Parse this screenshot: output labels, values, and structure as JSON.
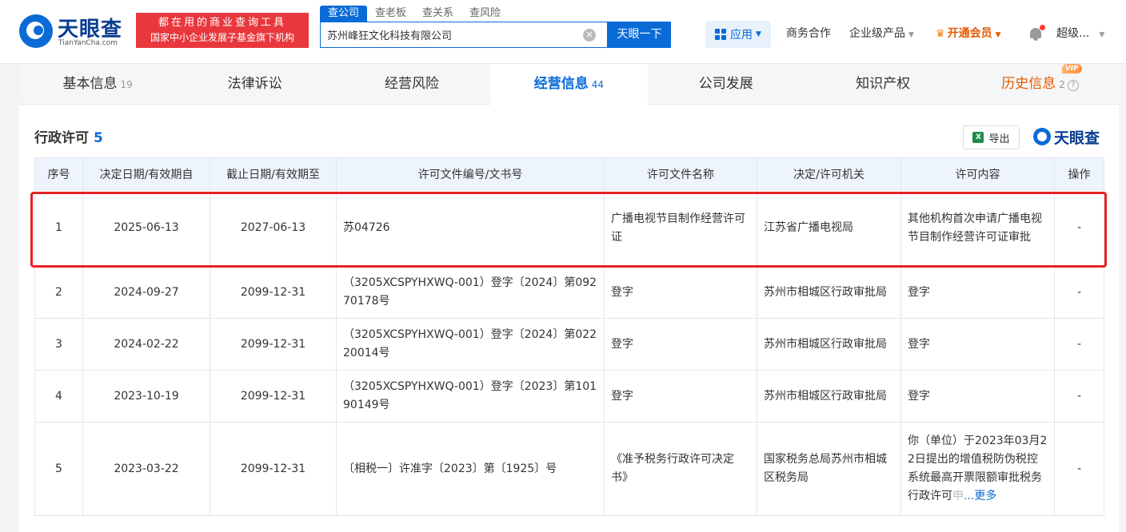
{
  "header": {
    "logo_name": "天眼查",
    "logo_pinyin": "TianYanCha.com",
    "slogan_line1": "都在用的商业查询工具",
    "slogan_line2": "国家中小企业发展子基金旗下机构",
    "search_tabs": [
      "查公司",
      "查老板",
      "查关系",
      "查风险"
    ],
    "search_value": "苏州峰狂文化科技有限公司",
    "search_button": "天眼一下",
    "apps_label": "应用",
    "nav": {
      "business": "商务合作",
      "enterprise": "企业级产品",
      "vip": "开通会员",
      "user": "超级..."
    }
  },
  "tabs": [
    {
      "label": "基本信息",
      "count": "19"
    },
    {
      "label": "法律诉讼",
      "count": ""
    },
    {
      "label": "经营风险",
      "count": ""
    },
    {
      "label": "经营信息",
      "count": "44"
    },
    {
      "label": "公司发展",
      "count": ""
    },
    {
      "label": "知识产权",
      "count": ""
    },
    {
      "label": "历史信息",
      "count": "2"
    }
  ],
  "vip_badge": "VIP",
  "section": {
    "title": "行政许可",
    "count": "5",
    "export_label": "导出",
    "brand": "天眼查"
  },
  "table": {
    "columns": [
      "序号",
      "决定日期/有效期自",
      "截止日期/有效期至",
      "许可文件编号/文书号",
      "许可文件名称",
      "决定/许可机关",
      "许可内容",
      "操作"
    ],
    "rows": [
      {
        "no": "1",
        "start": "2025-06-13",
        "end": "2027-06-13",
        "doc_no": "苏04726",
        "doc_name": "广播电视节目制作经营许可证",
        "authority": "江苏省广播电视局",
        "content": "其他机构首次申请广播电视节目制作经营许可证审批",
        "op": "-"
      },
      {
        "no": "2",
        "start": "2024-09-27",
        "end": "2099-12-31",
        "doc_no": "（3205XCSPYHXWQ-001）登字〔2024〕第09270178号",
        "doc_name": "登字",
        "authority": "苏州市相城区行政审批局",
        "content": "登字",
        "op": "-"
      },
      {
        "no": "3",
        "start": "2024-02-22",
        "end": "2099-12-31",
        "doc_no": "（3205XCSPYHXWQ-001）登字〔2024〕第02220014号",
        "doc_name": "登字",
        "authority": "苏州市相城区行政审批局",
        "content": "登字",
        "op": "-"
      },
      {
        "no": "4",
        "start": "2023-10-19",
        "end": "2099-12-31",
        "doc_no": "（3205XCSPYHXWQ-001）登字〔2023〕第10190149号",
        "doc_name": "登字",
        "authority": "苏州市相城区行政审批局",
        "content": "登字",
        "op": "-"
      },
      {
        "no": "5",
        "start": "2023-03-22",
        "end": "2099-12-31",
        "doc_no": "〔相税一〕许准字〔2023〕第〔1925〕号",
        "doc_name": "《准予税务行政许可决定书》",
        "authority": "国家税务总局苏州市相城区税务局",
        "content": "你（单位）于2023年03月22日提出的增值税防伪税控系统最高开票限额审批税务行政许可",
        "content_fade": "申",
        "op": "-"
      }
    ],
    "more_label": "...更多"
  }
}
